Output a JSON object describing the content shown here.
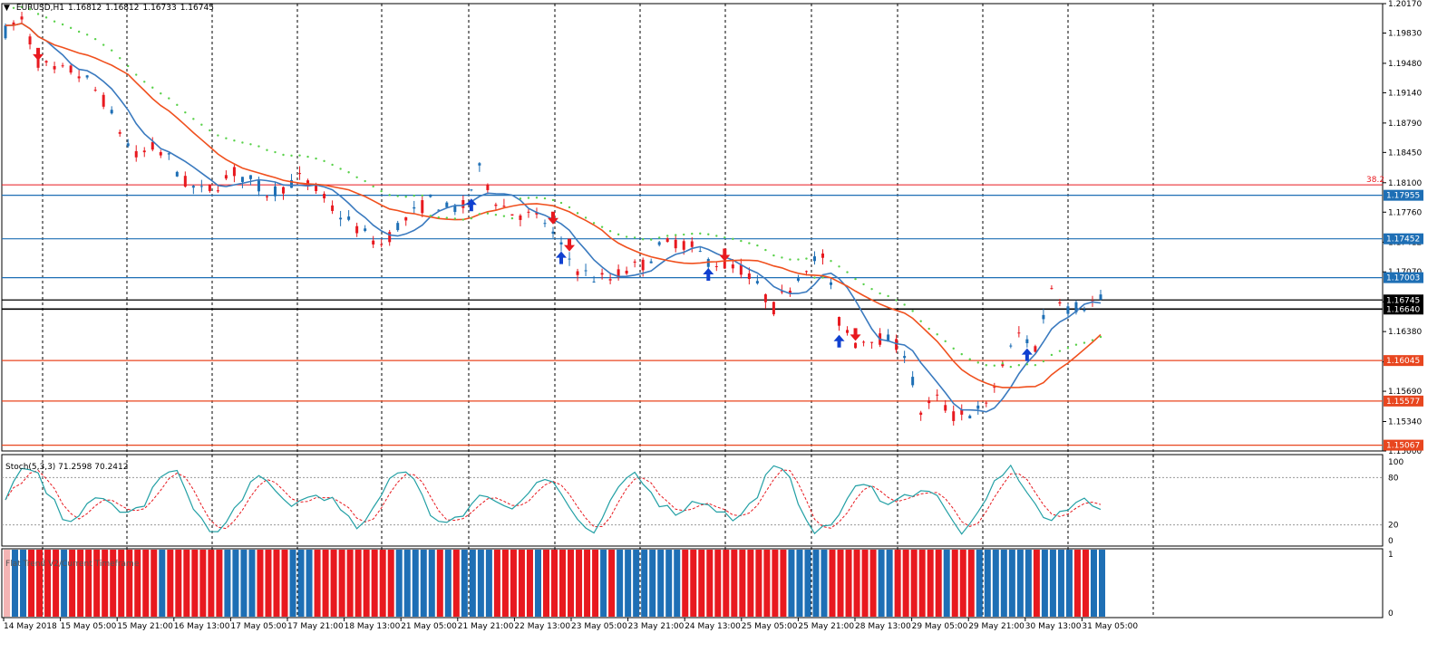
{
  "window": {
    "symbol": "EURUSD,H1",
    "ohlc": [
      "1.16812",
      "1.16812",
      "1.16733",
      "1.16745"
    ]
  },
  "price_axis": {
    "min": 1.15,
    "max": 1.2017,
    "labels": [
      "1.20170",
      "1.19830",
      "1.19480",
      "1.19140",
      "1.18790",
      "1.18450",
      "1.18100",
      "1.17760",
      "1.17412",
      "1.17070",
      "1.16724",
      "1.16380",
      "1.16030",
      "1.15690",
      "1.15340",
      "1.15000"
    ]
  },
  "levels": [
    {
      "label": "1.17955",
      "color": "#1e6fb5",
      "value": 1.17955
    },
    {
      "label": "1.17452",
      "color": "#1e6fb5",
      "value": 1.17452
    },
    {
      "label": "1.17003",
      "color": "#1e6fb5",
      "value": 1.17003
    },
    {
      "label": "1.16745",
      "color": "#000000",
      "value": 1.16745
    },
    {
      "label": "1.16640",
      "color": "#000000",
      "value": 1.1664
    },
    {
      "label": "1.16045",
      "color": "#e8461f",
      "value": 1.16045
    },
    {
      "label": "1.15577",
      "color": "#e8461f",
      "value": 1.15577
    },
    {
      "label": "1.15067",
      "color": "#e8461f",
      "value": 1.15067
    }
  ],
  "fib": {
    "label": "38.2",
    "value": 1.18075
  },
  "time_axis": [
    "14 May 2018",
    "15 May 05:00",
    "15 May 21:00",
    "16 May 13:00",
    "17 May 05:00",
    "17 May 21:00",
    "18 May 13:00",
    "21 May 05:00",
    "21 May 21:00",
    "22 May 13:00",
    "23 May 05:00",
    "23 May 21:00",
    "24 May 13:00",
    "25 May 05:00",
    "25 May 21:00",
    "28 May 13:00",
    "29 May 05:00",
    "29 May 21:00",
    "30 May 13:00",
    "31 May 05:00"
  ],
  "stoch": {
    "label": "Stoch(5,3,3) 71.2598 70.2412",
    "levels": [
      "100",
      "80",
      "20",
      "0"
    ]
  },
  "trend": {
    "label": "Flat Trend V2/Current Timeframe",
    "levels": [
      "1",
      "0"
    ]
  },
  "colors": {
    "bull": "#1e6fb5",
    "bear": "#e8191f",
    "fast_ma": "#3a7abf",
    "slow_ma": "#f0501e",
    "psar": "#59d14a",
    "stoch_main": "#23a0a5",
    "stoch_signal": "#e8191f"
  },
  "chart_data": {
    "type": "candlestick",
    "title": "EURUSD,H1",
    "close_path": [
      [
        0,
        1.1985
      ],
      [
        2,
        1.1998
      ],
      [
        4,
        1.195
      ],
      [
        6,
        1.1938
      ],
      [
        8,
        1.194
      ],
      [
        10,
        1.1928
      ],
      [
        12,
        1.1905
      ],
      [
        14,
        1.187
      ],
      [
        16,
        1.184
      ],
      [
        18,
        1.185
      ],
      [
        20,
        1.1838
      ],
      [
        22,
        1.181
      ],
      [
        24,
        1.18
      ],
      [
        26,
        1.1808
      ],
      [
        28,
        1.1822
      ],
      [
        30,
        1.1812
      ],
      [
        32,
        1.1798
      ],
      [
        34,
        1.1805
      ],
      [
        36,
        1.1815
      ],
      [
        38,
        1.1802
      ],
      [
        40,
        1.178
      ],
      [
        42,
        1.1765
      ],
      [
        44,
        1.175
      ],
      [
        46,
        1.1738
      ],
      [
        48,
        1.176
      ],
      [
        50,
        1.1775
      ],
      [
        52,
        1.179
      ],
      [
        54,
        1.178
      ],
      [
        56,
        1.1782
      ],
      [
        58,
        1.1825
      ],
      [
        60,
        1.179
      ],
      [
        62,
        1.1775
      ],
      [
        64,
        1.1772
      ],
      [
        66,
        1.1765
      ],
      [
        68,
        1.1735
      ],
      [
        70,
        1.171
      ],
      [
        72,
        1.17
      ],
      [
        74,
        1.1698
      ],
      [
        76,
        1.171
      ],
      [
        78,
        1.1715
      ],
      [
        80,
        1.1735
      ],
      [
        82,
        1.1742
      ],
      [
        84,
        1.1735
      ],
      [
        86,
        1.172
      ],
      [
        88,
        1.1715
      ],
      [
        90,
        1.171
      ],
      [
        92,
        1.169
      ],
      [
        94,
        1.1665
      ],
      [
        96,
        1.169
      ],
      [
        98,
        1.1715
      ],
      [
        100,
        1.1725
      ],
      [
        102,
        1.165
      ],
      [
        104,
        1.1625
      ],
      [
        106,
        1.1632
      ],
      [
        108,
        1.1628
      ],
      [
        110,
        1.1615
      ],
      [
        112,
        1.1545
      ],
      [
        114,
        1.156
      ],
      [
        116,
        1.154
      ],
      [
        118,
        1.1545
      ],
      [
        120,
        1.155
      ],
      [
        122,
        1.16
      ],
      [
        124,
        1.1635
      ],
      [
        126,
        1.162
      ],
      [
        128,
        1.169
      ],
      [
        130,
        1.1665
      ],
      [
        132,
        1.1668
      ],
      [
        134,
        1.1675
      ]
    ]
  }
}
